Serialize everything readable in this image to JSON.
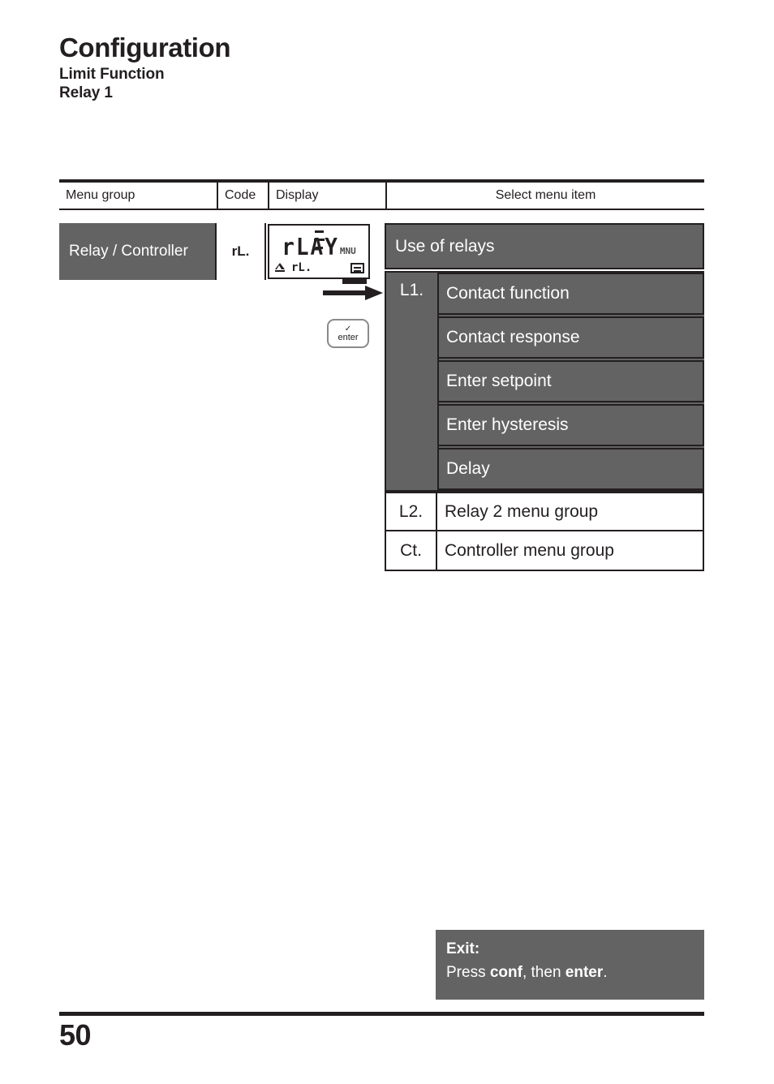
{
  "page": {
    "title": "Configuration",
    "subtitle1": "Limit Function",
    "subtitle2": "Relay 1",
    "number": "50"
  },
  "table": {
    "headers": {
      "menu_group": "Menu group",
      "code": "Code",
      "display": "Display",
      "select_menu_item": "Select menu item"
    },
    "row": {
      "menu_group": "Relay / Controller",
      "code": "rL."
    }
  },
  "lcd": {
    "top_icon": "sensor-icon",
    "main_text": "rLAY",
    "mode_text": "MNU",
    "warning_icon": "warning-triangle-icon",
    "bottom_code": "rL.",
    "right_icon": "meas-icon"
  },
  "keys": {
    "enter_check": "✓",
    "enter_label": "enter"
  },
  "menu": {
    "heading": "Use of relays",
    "group": {
      "code": "L1.",
      "items": [
        {
          "label": "Contact function"
        },
        {
          "label": "Contact response"
        },
        {
          "label": "Enter setpoint"
        },
        {
          "label": "Enter hysteresis"
        },
        {
          "label": "Delay"
        }
      ]
    },
    "rows": [
      {
        "code": "L2.",
        "label": "Relay 2 menu group"
      },
      {
        "code": "Ct.",
        "label": "Controller menu group"
      }
    ]
  },
  "exit": {
    "title": "Exit:",
    "prefix": "Press ",
    "key1": "conf",
    "middle": ", then ",
    "key2": "enter",
    "suffix": "."
  },
  "colors": {
    "gray_fill": "#636363",
    "ink": "#231f20"
  }
}
